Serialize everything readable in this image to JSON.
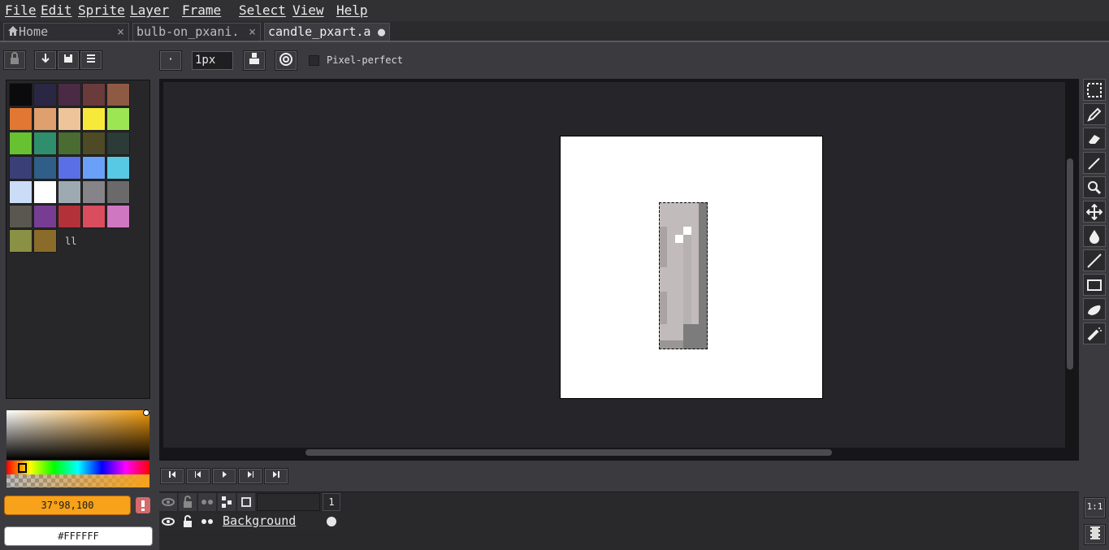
{
  "menu": [
    "File",
    "Edit",
    "Sprite",
    "Layer",
    "Frame",
    "Select",
    "View",
    "Help"
  ],
  "tabs": [
    {
      "label": "Home",
      "close": "×"
    },
    {
      "label": "bulb-on_pxani.",
      "close": "×"
    },
    {
      "label": "candle_pxart.a",
      "close": "●"
    }
  ],
  "toolbar": {
    "dot_label": "·",
    "brush_size": "1px",
    "pixel_perfect_label": "Pixel-perfect",
    "pixel_perfect_checked": false
  },
  "palette": {
    "colors": [
      "#0b0b0d",
      "#2a2744",
      "#4a2a44",
      "#6b3a3a",
      "#8e5a44",
      "#e07733",
      "#dea06e",
      "#eec49b",
      "#f7e93a",
      "#9de653",
      "#67c131",
      "#2f8e6b",
      "#4a6b31",
      "#4e4a26",
      "#2c3a38",
      "#3b3f78",
      "#2f5f88",
      "#5a6fe6",
      "#6aa0f7",
      "#57c9e4",
      "#cbdcf7",
      "#ffffff",
      "#9eaab1",
      "#878489",
      "#6a6a6a",
      "#5a5650",
      "#773d93",
      "#b3323a",
      "#d94d5e",
      "#d077c2",
      "#8a9044",
      "#8a6b2a"
    ],
    "grip": "ll"
  },
  "color": {
    "hsv_value": "37°98,100",
    "hex_value": "#FFFFFF",
    "accent": "#f7a21a"
  },
  "tools": [
    "rectangular-marquee",
    "pencil",
    "eraser",
    "eyedropper",
    "zoom",
    "move",
    "paint-bucket",
    "line",
    "rectangle",
    "blur",
    "spray"
  ],
  "playback": [
    "first-frame",
    "previous-frame",
    "play",
    "next-frame",
    "last-frame"
  ],
  "timeline": {
    "frame_number": "1",
    "layers": [
      {
        "name": "Background"
      }
    ]
  },
  "bottom_right": {
    "zoom_button": "1:1"
  }
}
